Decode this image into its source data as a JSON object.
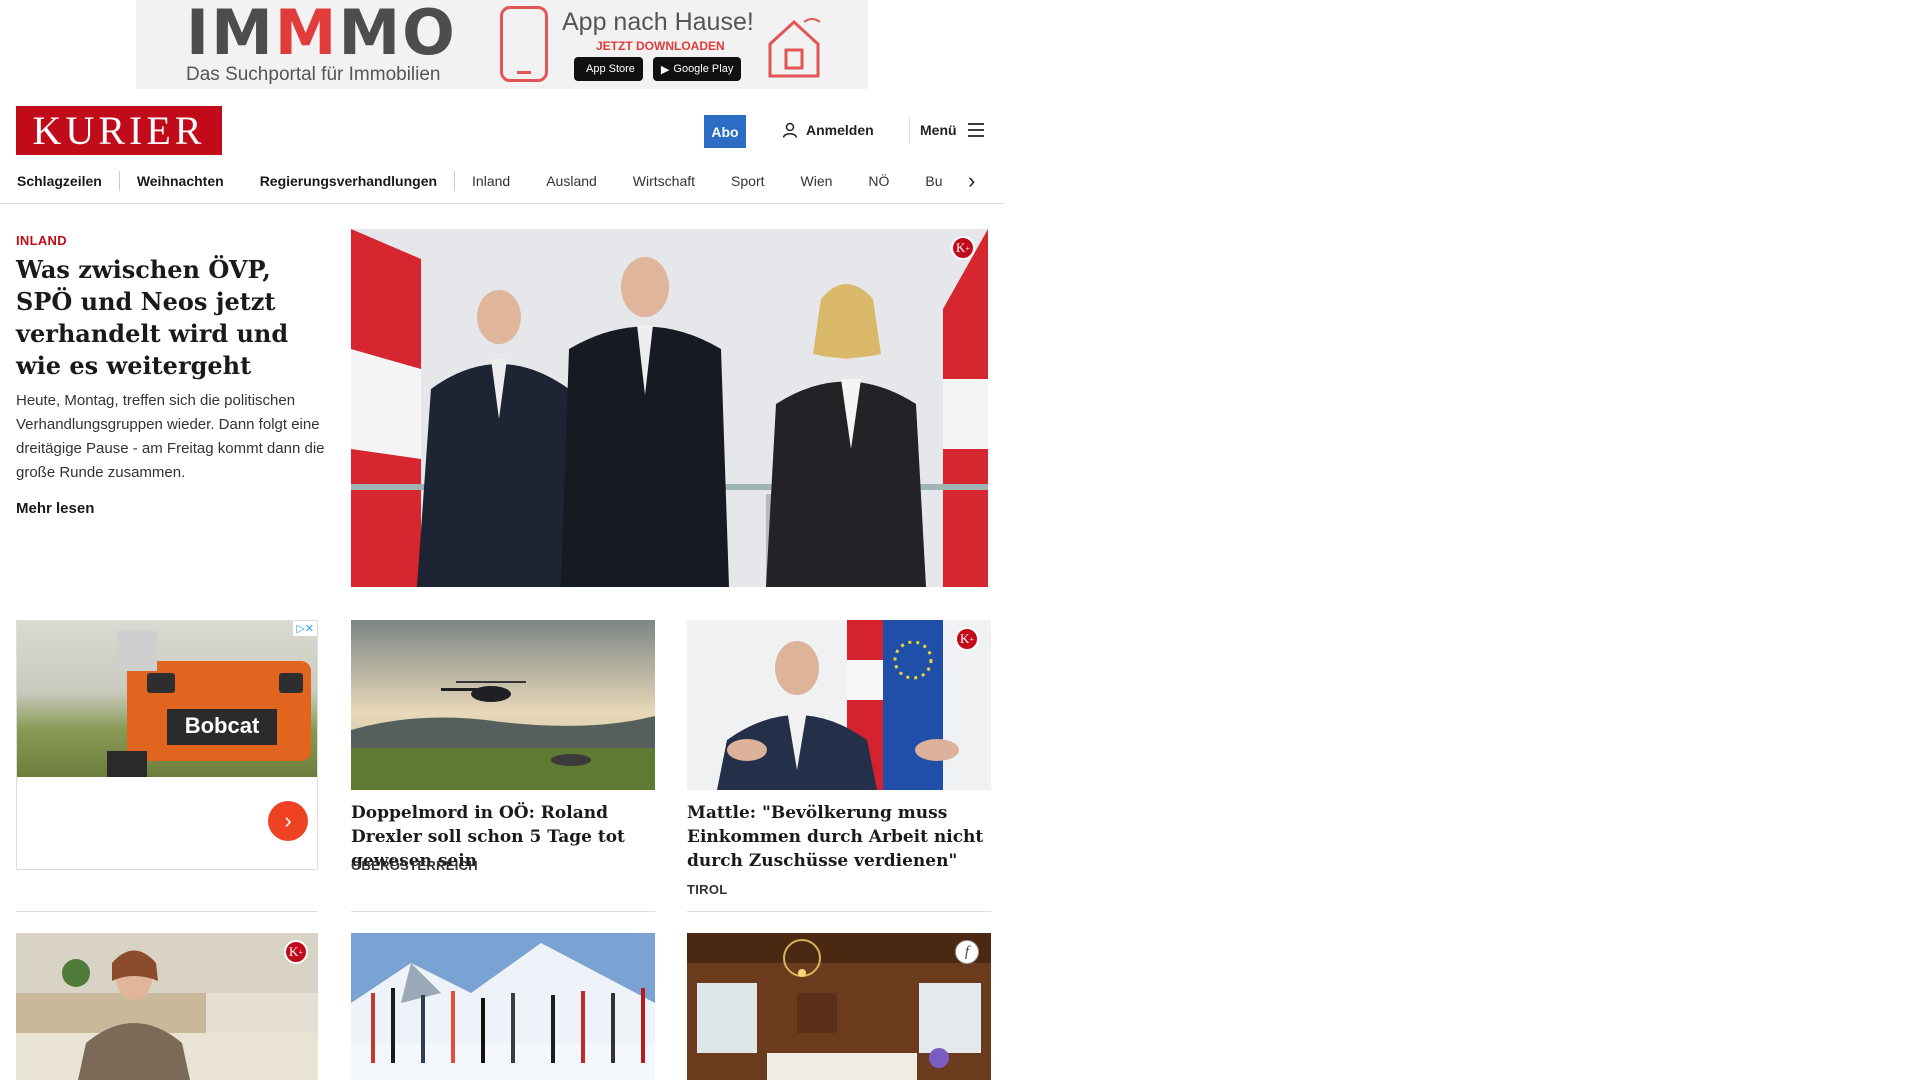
{
  "ad_banner": {
    "logo_prefix": "IM",
    "logo_highlight": "M",
    "logo_suffix": "MO",
    "tagline": "Das Suchportal für Immobilien",
    "app_title": "App nach Hause!",
    "app_subtitle": "JETZT DOWNLOADEN",
    "store_apple": "App Store",
    "store_google": "Google Play"
  },
  "header": {
    "logo": "KURIER",
    "abo": "Abo",
    "login": "Anmelden",
    "menu": "Menü"
  },
  "nav": {
    "items": [
      "Schlagzeilen",
      "Weihnachten",
      "Regierungsverhandlungen",
      "Inland",
      "Ausland",
      "Wirtschaft",
      "Sport",
      "Wien",
      "NÖ",
      "Bu"
    ]
  },
  "hero": {
    "category": "INLAND",
    "title": "Was zwischen ÖVP, SPÖ und Neos jetzt verhandelt wird und wie es weitergeht",
    "teaser": "Heute, Montag, treffen sich die politischen Verhandlungsgruppen wieder. Dann folgt eine dreitägige Pause - am Freitag kommt dann die große Runde zusammen.",
    "more": "Mehr lesen",
    "badge": "K"
  },
  "ad_card": {
    "brand": "Bobcat",
    "choices": "▷✕",
    "cta": "›"
  },
  "cards": [
    {
      "title": "Doppelmord in OÖ: Roland Drexler soll schon 5 Tage tot gewesen sein",
      "category": "OBERÖSTERREICH"
    },
    {
      "title": "Mattle: \"Bevölkerung muss Ein­kommen durch Arbeit nicht durch Zuschüsse verdienen\"",
      "category": "TIROL",
      "badge": "K"
    }
  ],
  "third_row": [
    {
      "badge": "K"
    },
    {},
    {
      "badge": "f"
    }
  ],
  "colors": {
    "brand_red": "#c10b1b",
    "abo_blue": "#2b6cc4",
    "ad_orange": "#ef4123"
  }
}
